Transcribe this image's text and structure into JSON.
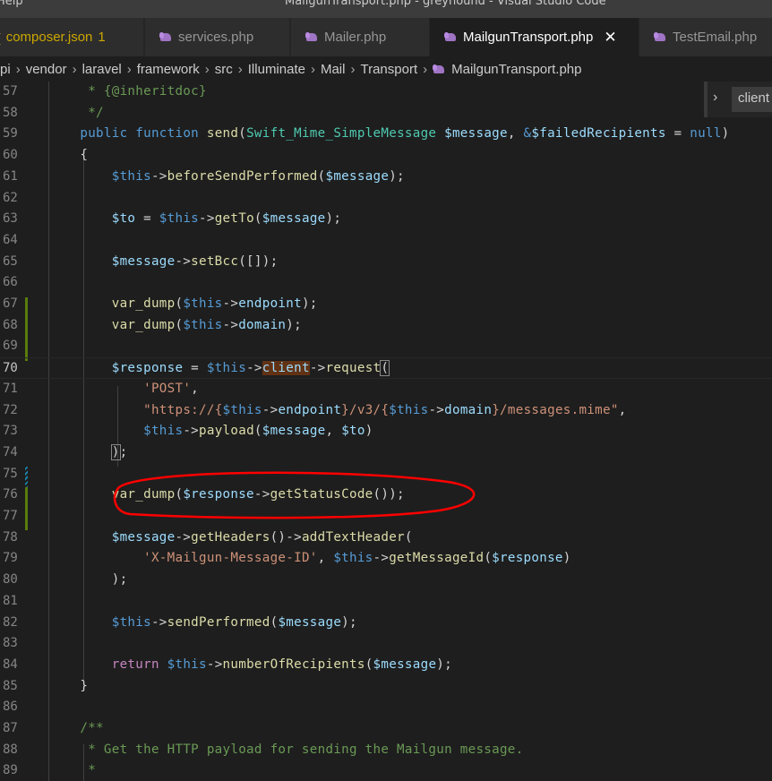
{
  "titlebar": {
    "menu_item": "Help",
    "window_title": "MailgunTransport.php - greyhound - Visual Studio Code"
  },
  "tabs": [
    {
      "label": "composer.json",
      "badge": "1",
      "icon": "json-icon",
      "state": "modified"
    },
    {
      "label": "services.php",
      "icon": "php-elephant-icon"
    },
    {
      "label": "Mailer.php",
      "icon": "php-elephant-icon"
    },
    {
      "label": "MailgunTransport.php",
      "icon": "php-elephant-icon",
      "active": true,
      "close": "✕"
    },
    {
      "label": "TestEmail.php",
      "icon": "php-elephant-icon"
    }
  ],
  "breadcrumb": {
    "items": [
      "pi",
      "vendor",
      "laravel",
      "framework",
      "src",
      "Illuminate",
      "Mail",
      "Transport",
      "MailgunTransport.php"
    ],
    "separator": "›"
  },
  "sticky_widget": {
    "chevron": "›",
    "word": "client"
  },
  "editor": {
    "current_line": "70",
    "lines": [
      {
        "n": "57",
        "text": "     * {@inheritdoc}"
      },
      {
        "n": "58",
        "text": "     */"
      },
      {
        "n": "59",
        "text": "    public function send(Swift_Mime_SimpleMessage $message, &$failedRecipients = null)"
      },
      {
        "n": "60",
        "text": "    {"
      },
      {
        "n": "61",
        "text": "        $this->beforeSendPerformed($message);"
      },
      {
        "n": "62",
        "text": ""
      },
      {
        "n": "63",
        "text": "        $to = $this->getTo($message);"
      },
      {
        "n": "64",
        "text": ""
      },
      {
        "n": "65",
        "text": "        $message->setBcc([]);"
      },
      {
        "n": "66",
        "text": ""
      },
      {
        "n": "67",
        "text": "        var_dump($this->endpoint);"
      },
      {
        "n": "68",
        "text": "        var_dump($this->domain);"
      },
      {
        "n": "69",
        "text": ""
      },
      {
        "n": "70",
        "text": "        $response = $this->client->request("
      },
      {
        "n": "71",
        "text": "            'POST',"
      },
      {
        "n": "72",
        "text": "            \"https://{$this->endpoint}/v3/{$this->domain}/messages.mime\","
      },
      {
        "n": "73",
        "text": "            $this->payload($message, $to)"
      },
      {
        "n": "74",
        "text": "        );"
      },
      {
        "n": "75",
        "text": ""
      },
      {
        "n": "76",
        "text": "        var_dump($response->getStatusCode());"
      },
      {
        "n": "77",
        "text": ""
      },
      {
        "n": "78",
        "text": "        $message->getHeaders()->addTextHeader("
      },
      {
        "n": "79",
        "text": "            'X-Mailgun-Message-ID', $this->getMessageId($response)"
      },
      {
        "n": "80",
        "text": "        );"
      },
      {
        "n": "81",
        "text": ""
      },
      {
        "n": "82",
        "text": "        $this->sendPerformed($message);"
      },
      {
        "n": "83",
        "text": ""
      },
      {
        "n": "84",
        "text": "        return $this->numberOfRecipients($message);"
      },
      {
        "n": "85",
        "text": "    }"
      },
      {
        "n": "86",
        "text": ""
      },
      {
        "n": "87",
        "text": "    /**"
      },
      {
        "n": "88",
        "text": "     * Get the HTTP payload for sending the Mailgun message."
      },
      {
        "n": "89",
        "text": "     *"
      }
    ]
  },
  "annotation": {
    "description": "red hand-drawn circle around line 76",
    "color": "#ff0000"
  },
  "colors": {
    "keyword": "#569cd6",
    "function": "#dcdcaa",
    "variable": "#9cdcfe",
    "class": "#4ec9b0",
    "string": "#ce9178",
    "comment": "#6a9955",
    "control": "#c586c0",
    "added_gutter": "#587c0c",
    "modified_gutter": "#1b81a8",
    "word_highlight": "#613214"
  }
}
